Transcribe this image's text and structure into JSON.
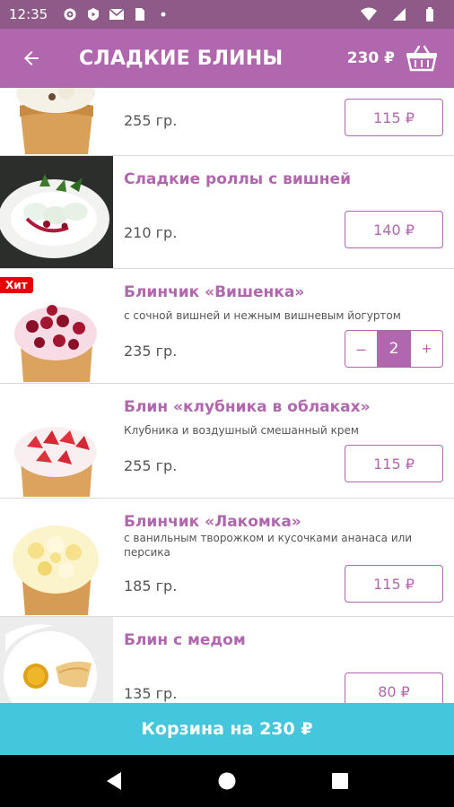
{
  "status_bar": {
    "time": "12:35",
    "icons": [
      "gear-icon",
      "shield-play-icon",
      "mail-icon",
      "sim-card-icon",
      "dot-icon",
      "wifi-icon",
      "signal-icon",
      "battery-icon"
    ]
  },
  "app_bar": {
    "title": "СЛАДКИЕ БЛИНЫ",
    "cart_total": "230 ₽",
    "back_icon": "arrow-left-icon",
    "basket_icon": "basket-icon"
  },
  "items": [
    {
      "name": "",
      "description": "",
      "weight": "255 гр.",
      "price": "115 ₽",
      "image": "cream-pancake-top"
    },
    {
      "name": "Сладкие роллы с вишней",
      "description": "",
      "weight": "210 гр.",
      "price": "140 ₽",
      "image": "rolls-with-cherry"
    },
    {
      "name": "Блинчик «Вишенка»",
      "description": "с сочной вишней и нежным вишневым йогуртом",
      "weight": "235 гр.",
      "badge": "Хит",
      "quantity": "2",
      "minus": "–",
      "plus": "+",
      "image": "cherry-pancake"
    },
    {
      "name": "Блин «клубника в облаках»",
      "description": "Клубника и воздушный смешанный крем",
      "weight": "255 гр.",
      "price": "115 ₽",
      "image": "strawberry-pancake"
    },
    {
      "name": "Блинчик «Лакомка»",
      "description": "с ванильным творожком и кусочками ананаса или персика",
      "weight": "185 гр.",
      "price": "115 ₽",
      "image": "pineapple-pancake"
    },
    {
      "name": "Блин с медом",
      "description": "",
      "weight": "135 гр.",
      "price": "80 ₽",
      "image": "pancake-with-honey"
    }
  ],
  "cart_button": {
    "label": "Корзина на 230 ₽"
  },
  "nav": {
    "back": "back-triangle-icon",
    "home": "home-circle-icon",
    "recents": "recents-square-icon"
  },
  "colors": {
    "primary": "#b167ad",
    "status": "#8e5a88",
    "accent": "#44c6dc",
    "badge": "#e60000"
  }
}
